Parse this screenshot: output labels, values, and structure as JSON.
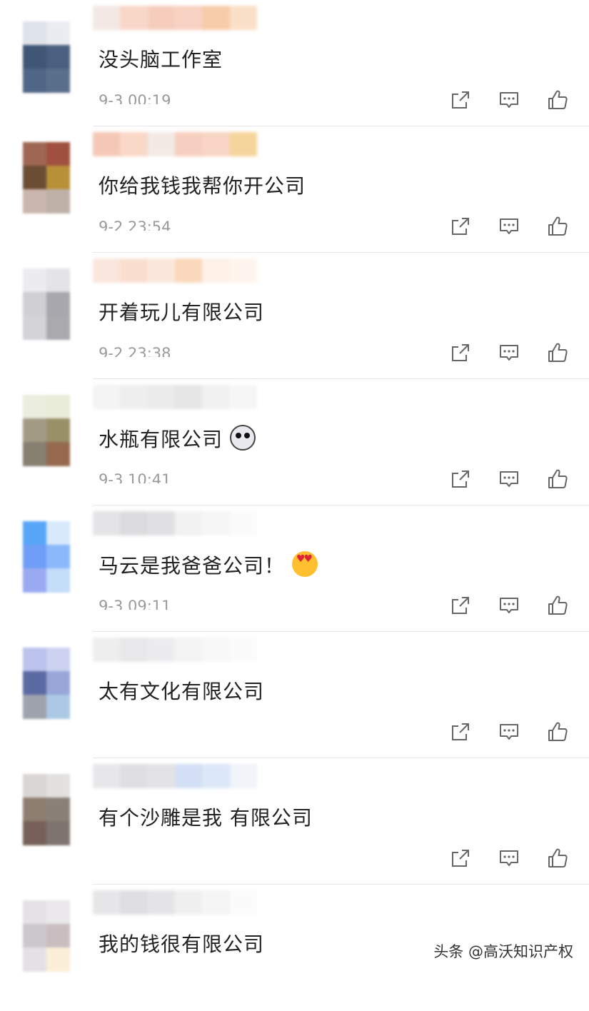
{
  "comments": [
    {
      "text": "没头脑工作室",
      "time": "9-3 00:19",
      "emoji": "",
      "avatar": [
        "#dfe3ea",
        "#e9ecf1",
        "#3f5775",
        "#4a6080",
        "#4f6687",
        "#5a6f8c"
      ],
      "name": [
        "#f4e8e4",
        "#f8d7c9",
        "#f6cdbd",
        "#f8d2c2",
        "#f7ccaa",
        "#fae0c8"
      ]
    },
    {
      "text": "你给我钱我帮你开公司",
      "time": "9-2 23:54",
      "emoji": "",
      "avatar": [
        "#a06654",
        "#a0503e",
        "#6b4d33",
        "#b89038",
        "#cbb6ae",
        "#bdb1a8"
      ],
      "name": [
        "#f5c8b6",
        "#fad8c8",
        "#f3eae6",
        "#f7cfc0",
        "#f8d5c5",
        "#f6d59c"
      ]
    },
    {
      "text": "开着玩儿有限公司",
      "time": "9-2 23:38",
      "emoji": "",
      "avatar": [
        "#ececef",
        "#e4e4e7",
        "#cfcfd4",
        "#a7a7ad",
        "#d4d4d8",
        "#a9a9ae"
      ],
      "name": [
        "#fae6dc",
        "#fadfd0",
        "#fbe8dc",
        "#f9d8bc",
        "#fdf1e7",
        "#fff5ee"
      ]
    },
    {
      "text": "水瓶有限公司",
      "time": "9-3 10:41",
      "emoji": "dog",
      "avatar": [
        "#ebeddf",
        "#e8ecd9",
        "#a39a86",
        "#9a9067",
        "#877f70",
        "#96694e"
      ],
      "name": [
        "#f4f4f5",
        "#eeeeef",
        "#ebebec",
        "#e6e6e7",
        "#f1f1f2",
        "#f6f6f6"
      ]
    },
    {
      "text": "马云是我爸爸公司！",
      "time": "9-3 09:11",
      "emoji": "heart",
      "avatar": [
        "#58a6f8",
        "#d8e9fb",
        "#6f9ef6",
        "#8ab8fa",
        "#9aaaf2",
        "#c4ddf9"
      ],
      "name": [
        "#e4e4e6",
        "#dcdcde",
        "#e1e1e3",
        "#f2f2f3",
        "#f6f6f7",
        "#fbfbfb"
      ]
    },
    {
      "text": "太有文化有限公司",
      "time": "",
      "emoji": "",
      "avatar": [
        "#bcc3ec",
        "#ccd2f0",
        "#5c6aa3",
        "#98a6d8",
        "#9ea3ad",
        "#abc9e4"
      ],
      "name": [
        "#eeeeef",
        "#e8e8ea",
        "#ececee",
        "#f4f4f5",
        "#f8f8f9",
        "#fbfbfb"
      ]
    },
    {
      "text": "有个沙雕是我 有限公司",
      "time": "",
      "emoji": "",
      "avatar": [
        "#d9d6d4",
        "#e3e1df",
        "#8e7e70",
        "#8b8077",
        "#776057",
        "#7f7470"
      ],
      "name": [
        "#e7e7e9",
        "#dfdfe2",
        "#e3e3e6",
        "#d3dff5",
        "#dce7f8",
        "#f1f4f9"
      ]
    },
    {
      "text": "我的钱很有限公司",
      "time": "",
      "emoji": "",
      "avatar": [
        "#e4e2e5",
        "#eae8ea",
        "#cbc8cd",
        "#c9bdc0",
        "#e4e1e6",
        "#fbefd8"
      ],
      "name": [
        "#e6e6e8",
        "#dfdfe1",
        "#e5e5e7",
        "#f0f0f1",
        "#f5f5f6",
        "#fbfbfb"
      ]
    }
  ],
  "icons": {
    "share": "share-icon",
    "reply": "reply-icon",
    "like": "thumbs-up-icon"
  },
  "watermark": "头条 @高沃知识产权"
}
